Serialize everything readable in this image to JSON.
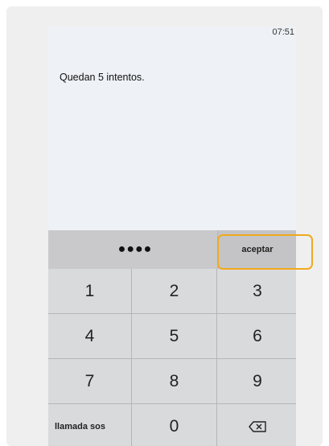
{
  "status": {
    "time": "07:51"
  },
  "message": "Quedan 5 intentos.",
  "pin": {
    "dots": "●●●●"
  },
  "accept_label": "aceptar",
  "keys": {
    "k1": "1",
    "k2": "2",
    "k3": "3",
    "k4": "4",
    "k5": "5",
    "k6": "6",
    "k7": "7",
    "k8": "8",
    "k9": "9",
    "sos": "llamada sos",
    "k0": "0",
    "backspace_icon": "backspace-icon"
  },
  "colors": {
    "highlight": "#f0a91e",
    "keypad_bg": "#d9dadc",
    "pin_bar_bg": "#c9c9cb"
  }
}
